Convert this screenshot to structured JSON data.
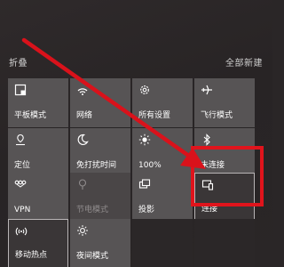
{
  "header": {
    "collapse_label": "折叠",
    "all_settings_label": "全部新建"
  },
  "tiles": {
    "tablet_mode": "平板模式",
    "network": "网络",
    "all_settings": "所有设置",
    "airplane_mode": "飞行模式",
    "location": "定位",
    "quiet_hours": "免打扰时间",
    "brightness": "100%",
    "bluetooth": "未连接",
    "vpn": "VPN",
    "battery_saver": "节电模式",
    "project": "投影",
    "connect": "连接",
    "mobile_hotspot": "移动热点",
    "night_light": "夜间模式"
  },
  "annotation": {
    "arrow_color": "#d9121b",
    "box_color": "#e0141c"
  }
}
